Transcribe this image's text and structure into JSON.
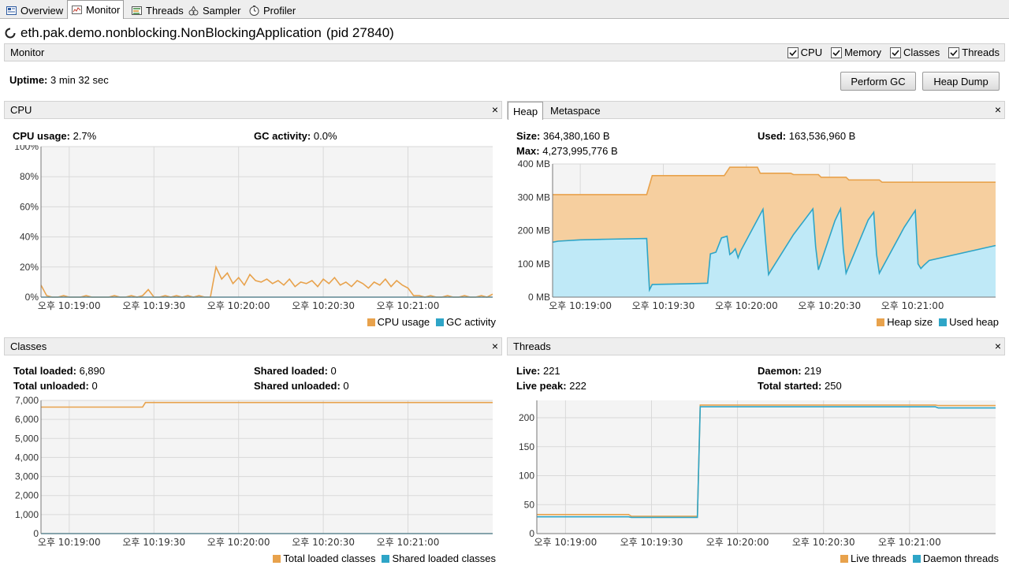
{
  "tabs": [
    {
      "label": "Overview",
      "icon": "overview-icon"
    },
    {
      "label": "Monitor",
      "icon": "monitor-icon"
    },
    {
      "label": "Threads",
      "icon": "threads-icon"
    },
    {
      "label": "Sampler",
      "icon": "sampler-icon"
    },
    {
      "label": "Profiler",
      "icon": "profiler-icon"
    }
  ],
  "app": {
    "name": "eth.pak.demo.nonblocking.NonBlockingApplication",
    "pid": "(pid 27840)"
  },
  "monitor": {
    "label": "Monitor",
    "checkboxes": [
      {
        "label": "CPU",
        "checked": true
      },
      {
        "label": "Memory",
        "checked": true
      },
      {
        "label": "Classes",
        "checked": true
      },
      {
        "label": "Threads",
        "checked": true
      }
    ],
    "uptime_label": "Uptime:",
    "uptime_value": "3 min 32 sec",
    "perform_gc": "Perform GC",
    "heap_dump": "Heap Dump"
  },
  "colors": {
    "orange": "#e8a24c",
    "orange_fill": "#f6cf9f",
    "blue": "#2ea5c7",
    "blue_fill": "#bfe9f7",
    "grid": "#d9d9d9",
    "plot_bg": "#f4f4f4"
  },
  "close_glyph": "×",
  "cpu": {
    "title": "CPU",
    "usage_label": "CPU usage:",
    "usage_value": "2.7%",
    "gc_label": "GC activity:",
    "gc_value": "0.0%"
  },
  "heap": {
    "tab_heap": "Heap",
    "tab_metaspace": "Metaspace",
    "size_label": "Size:",
    "size_value": "364,380,160 B",
    "max_label": "Max:",
    "max_value": "4,273,995,776 B",
    "used_label": "Used:",
    "used_value": "163,536,960 B"
  },
  "classes": {
    "title": "Classes",
    "total_loaded_label": "Total loaded:",
    "total_loaded_value": "6,890",
    "total_unloaded_label": "Total unloaded:",
    "total_unloaded_value": "0",
    "shared_loaded_label": "Shared loaded:",
    "shared_loaded_value": "0",
    "shared_unloaded_label": "Shared unloaded:",
    "shared_unloaded_value": "0"
  },
  "threads": {
    "title": "Threads",
    "live_label": "Live:",
    "live_value": "221",
    "peak_label": "Live peak:",
    "peak_value": "222",
    "daemon_label": "Daemon:",
    "daemon_value": "219",
    "started_label": "Total started:",
    "started_value": "250"
  },
  "chart_data": [
    {
      "type": "line",
      "title": "",
      "x": [
        0,
        2,
        4,
        6,
        8,
        10,
        12,
        14,
        16,
        18,
        20,
        22,
        24,
        26,
        28,
        30,
        32,
        34,
        36,
        38,
        40,
        42,
        44,
        46,
        48,
        50,
        52,
        54,
        56,
        58,
        60,
        62,
        64,
        66,
        68,
        70,
        72,
        74,
        76,
        78,
        80,
        82,
        84,
        86,
        88,
        90,
        92,
        94,
        96,
        98,
        100,
        102,
        104,
        106,
        108,
        110,
        112,
        114,
        116,
        118,
        120,
        122,
        124,
        126,
        128,
        130,
        132,
        134,
        136,
        138,
        140,
        142,
        144,
        146,
        148,
        150,
        152,
        154,
        156,
        158,
        160
      ],
      "x_ticks": [
        10,
        40,
        70,
        100,
        130
      ],
      "x_tick_labels": [
        "오후 10:19:00",
        "오후 10:19:30",
        "오후 10:20:00",
        "오후 10:20:30",
        "오후 10:21:00"
      ],
      "y_ticks": [
        0,
        20,
        40,
        60,
        80,
        100
      ],
      "y_tick_labels": [
        "0%",
        "20%",
        "40%",
        "60%",
        "80%",
        "100%"
      ],
      "ylim": [
        0,
        100
      ],
      "series": [
        {
          "name": "CPU usage",
          "color": "#e8a24c",
          "values": [
            8,
            1,
            0,
            0,
            1,
            0,
            0,
            0,
            1,
            0,
            0,
            0,
            0,
            1,
            0,
            0,
            1,
            0,
            1,
            5,
            0,
            0,
            1,
            0,
            1,
            0,
            1,
            0,
            1,
            0,
            0,
            20,
            12,
            16,
            9,
            13,
            8,
            15,
            11,
            10,
            12,
            9,
            11,
            8,
            12,
            7,
            10,
            9,
            11,
            7,
            12,
            9,
            13,
            8,
            10,
            7,
            11,
            9,
            6,
            10,
            8,
            12,
            7,
            11,
            8,
            6,
            1,
            1,
            0,
            1,
            0,
            0,
            1,
            0,
            0,
            1,
            0,
            0,
            1,
            0,
            2
          ]
        },
        {
          "name": "GC activity",
          "color": "#2ea5c7",
          "values": [
            0,
            0,
            0,
            0,
            0,
            0,
            0,
            0,
            0,
            0,
            0,
            0,
            0,
            0,
            0,
            0,
            0,
            0,
            0,
            0,
            0,
            0,
            0,
            0,
            0,
            0,
            0,
            0,
            0,
            0,
            0,
            0,
            0,
            0,
            0,
            0,
            0,
            0,
            0,
            0,
            0,
            0,
            0,
            0,
            0,
            0,
            0,
            0,
            0,
            0,
            0,
            0,
            0,
            0,
            0,
            0,
            0,
            0,
            0,
            0,
            0,
            0,
            0,
            0,
            0,
            0,
            0,
            0,
            0,
            0,
            0,
            0,
            0,
            0,
            0,
            0,
            0,
            0,
            0,
            0,
            0
          ]
        }
      ],
      "legend": [
        "CPU usage",
        "GC activity"
      ]
    },
    {
      "type": "area",
      "title": "",
      "x_ticks": [
        10,
        40,
        70,
        100,
        130
      ],
      "x_tick_labels": [
        "오후 10:19:00",
        "오후 10:19:30",
        "오후 10:20:00",
        "오후 10:20:30",
        "오후 10:21:00"
      ],
      "y_ticks": [
        0,
        100,
        200,
        300,
        400
      ],
      "y_tick_labels": [
        "0 MB",
        "100 MB",
        "200 MB",
        "300 MB",
        "400 MB"
      ],
      "xlim": [
        0,
        160
      ],
      "ylim": [
        0,
        400
      ],
      "series": [
        {
          "name": "Heap size",
          "color": "#e8a24c",
          "points": [
            [
              0,
              308
            ],
            [
              34,
              308
            ],
            [
              36,
              365
            ],
            [
              62,
              365
            ],
            [
              64,
              390
            ],
            [
              74,
              390
            ],
            [
              75,
              372
            ],
            [
              86,
              372
            ],
            [
              87,
              368
            ],
            [
              96,
              368
            ],
            [
              97,
              360
            ],
            [
              106,
              360
            ],
            [
              107,
              352
            ],
            [
              118,
              352
            ],
            [
              119,
              345
            ],
            [
              160,
              345
            ]
          ]
        },
        {
          "name": "Used heap",
          "color": "#2ea5c7",
          "points": [
            [
              0,
              165
            ],
            [
              2,
              168
            ],
            [
              10,
              172
            ],
            [
              20,
              174
            ],
            [
              34,
              176
            ],
            [
              35,
              22
            ],
            [
              36,
              38
            ],
            [
              48,
              40
            ],
            [
              56,
              42
            ],
            [
              57,
              130
            ],
            [
              59,
              135
            ],
            [
              61,
              178
            ],
            [
              63,
              183
            ],
            [
              64,
              128
            ],
            [
              65,
              135
            ],
            [
              66,
              145
            ],
            [
              67,
              118
            ],
            [
              68,
              140
            ],
            [
              76,
              264
            ],
            [
              77,
              160
            ],
            [
              78,
              68
            ],
            [
              79,
              82
            ],
            [
              87,
              188
            ],
            [
              94,
              265
            ],
            [
              95,
              152
            ],
            [
              96,
              82
            ],
            [
              102,
              230
            ],
            [
              104,
              265
            ],
            [
              105,
              142
            ],
            [
              106,
              72
            ],
            [
              114,
              232
            ],
            [
              116,
              255
            ],
            [
              117,
              128
            ],
            [
              118,
              72
            ],
            [
              127,
              210
            ],
            [
              131,
              260
            ],
            [
              132,
              100
            ],
            [
              133,
              86
            ],
            [
              134,
              95
            ],
            [
              136,
              110
            ],
            [
              160,
              155
            ]
          ]
        }
      ],
      "legend": [
        "Heap size",
        "Used heap"
      ]
    },
    {
      "type": "line",
      "title": "",
      "x_ticks": [
        10,
        40,
        70,
        100,
        130
      ],
      "x_tick_labels": [
        "오후 10:19:00",
        "오후 10:19:30",
        "오후 10:20:00",
        "오후 10:20:30",
        "오후 10:21:00"
      ],
      "y_ticks": [
        0,
        1000,
        2000,
        3000,
        4000,
        5000,
        6000,
        7000
      ],
      "y_tick_labels": [
        "0",
        "1,000",
        "2,000",
        "3,000",
        "4,000",
        "5,000",
        "6,000",
        "7,000"
      ],
      "xlim": [
        0,
        160
      ],
      "ylim": [
        0,
        7000
      ],
      "series": [
        {
          "name": "Total loaded classes",
          "color": "#e8a24c",
          "points": [
            [
              0,
              6650
            ],
            [
              36,
              6650
            ],
            [
              37,
              6890
            ],
            [
              160,
              6890
            ]
          ]
        },
        {
          "name": "Shared loaded classes",
          "color": "#2ea5c7",
          "points": [
            [
              0,
              0
            ],
            [
              160,
              0
            ]
          ]
        }
      ],
      "legend": [
        "Total loaded classes",
        "Shared loaded classes"
      ]
    },
    {
      "type": "line",
      "title": "",
      "x_ticks": [
        10,
        40,
        70,
        100,
        130
      ],
      "x_tick_labels": [
        "오후 10:19:00",
        "오후 10:19:30",
        "오후 10:20:00",
        "오후 10:20:30",
        "오후 10:21:00"
      ],
      "y_ticks": [
        0,
        50,
        100,
        150,
        200
      ],
      "y_tick_labels": [
        "0",
        "50",
        "100",
        "150",
        "200"
      ],
      "xlim": [
        0,
        160
      ],
      "ylim": [
        0,
        230
      ],
      "series": [
        {
          "name": "Live threads",
          "color": "#e8a24c",
          "points": [
            [
              0,
              33
            ],
            [
              32,
              33
            ],
            [
              33,
              30
            ],
            [
              56,
              30
            ],
            [
              57,
              222
            ],
            [
              139,
              222
            ],
            [
              140,
              221
            ],
            [
              160,
              221
            ]
          ]
        },
        {
          "name": "Daemon threads",
          "color": "#2ea5c7",
          "points": [
            [
              0,
              29
            ],
            [
              32,
              29
            ],
            [
              33,
              28
            ],
            [
              56,
              28
            ],
            [
              57,
              219
            ],
            [
              139,
              219
            ],
            [
              140,
              217
            ],
            [
              160,
              217
            ]
          ]
        }
      ],
      "legend": [
        "Live threads",
        "Daemon threads"
      ]
    }
  ]
}
